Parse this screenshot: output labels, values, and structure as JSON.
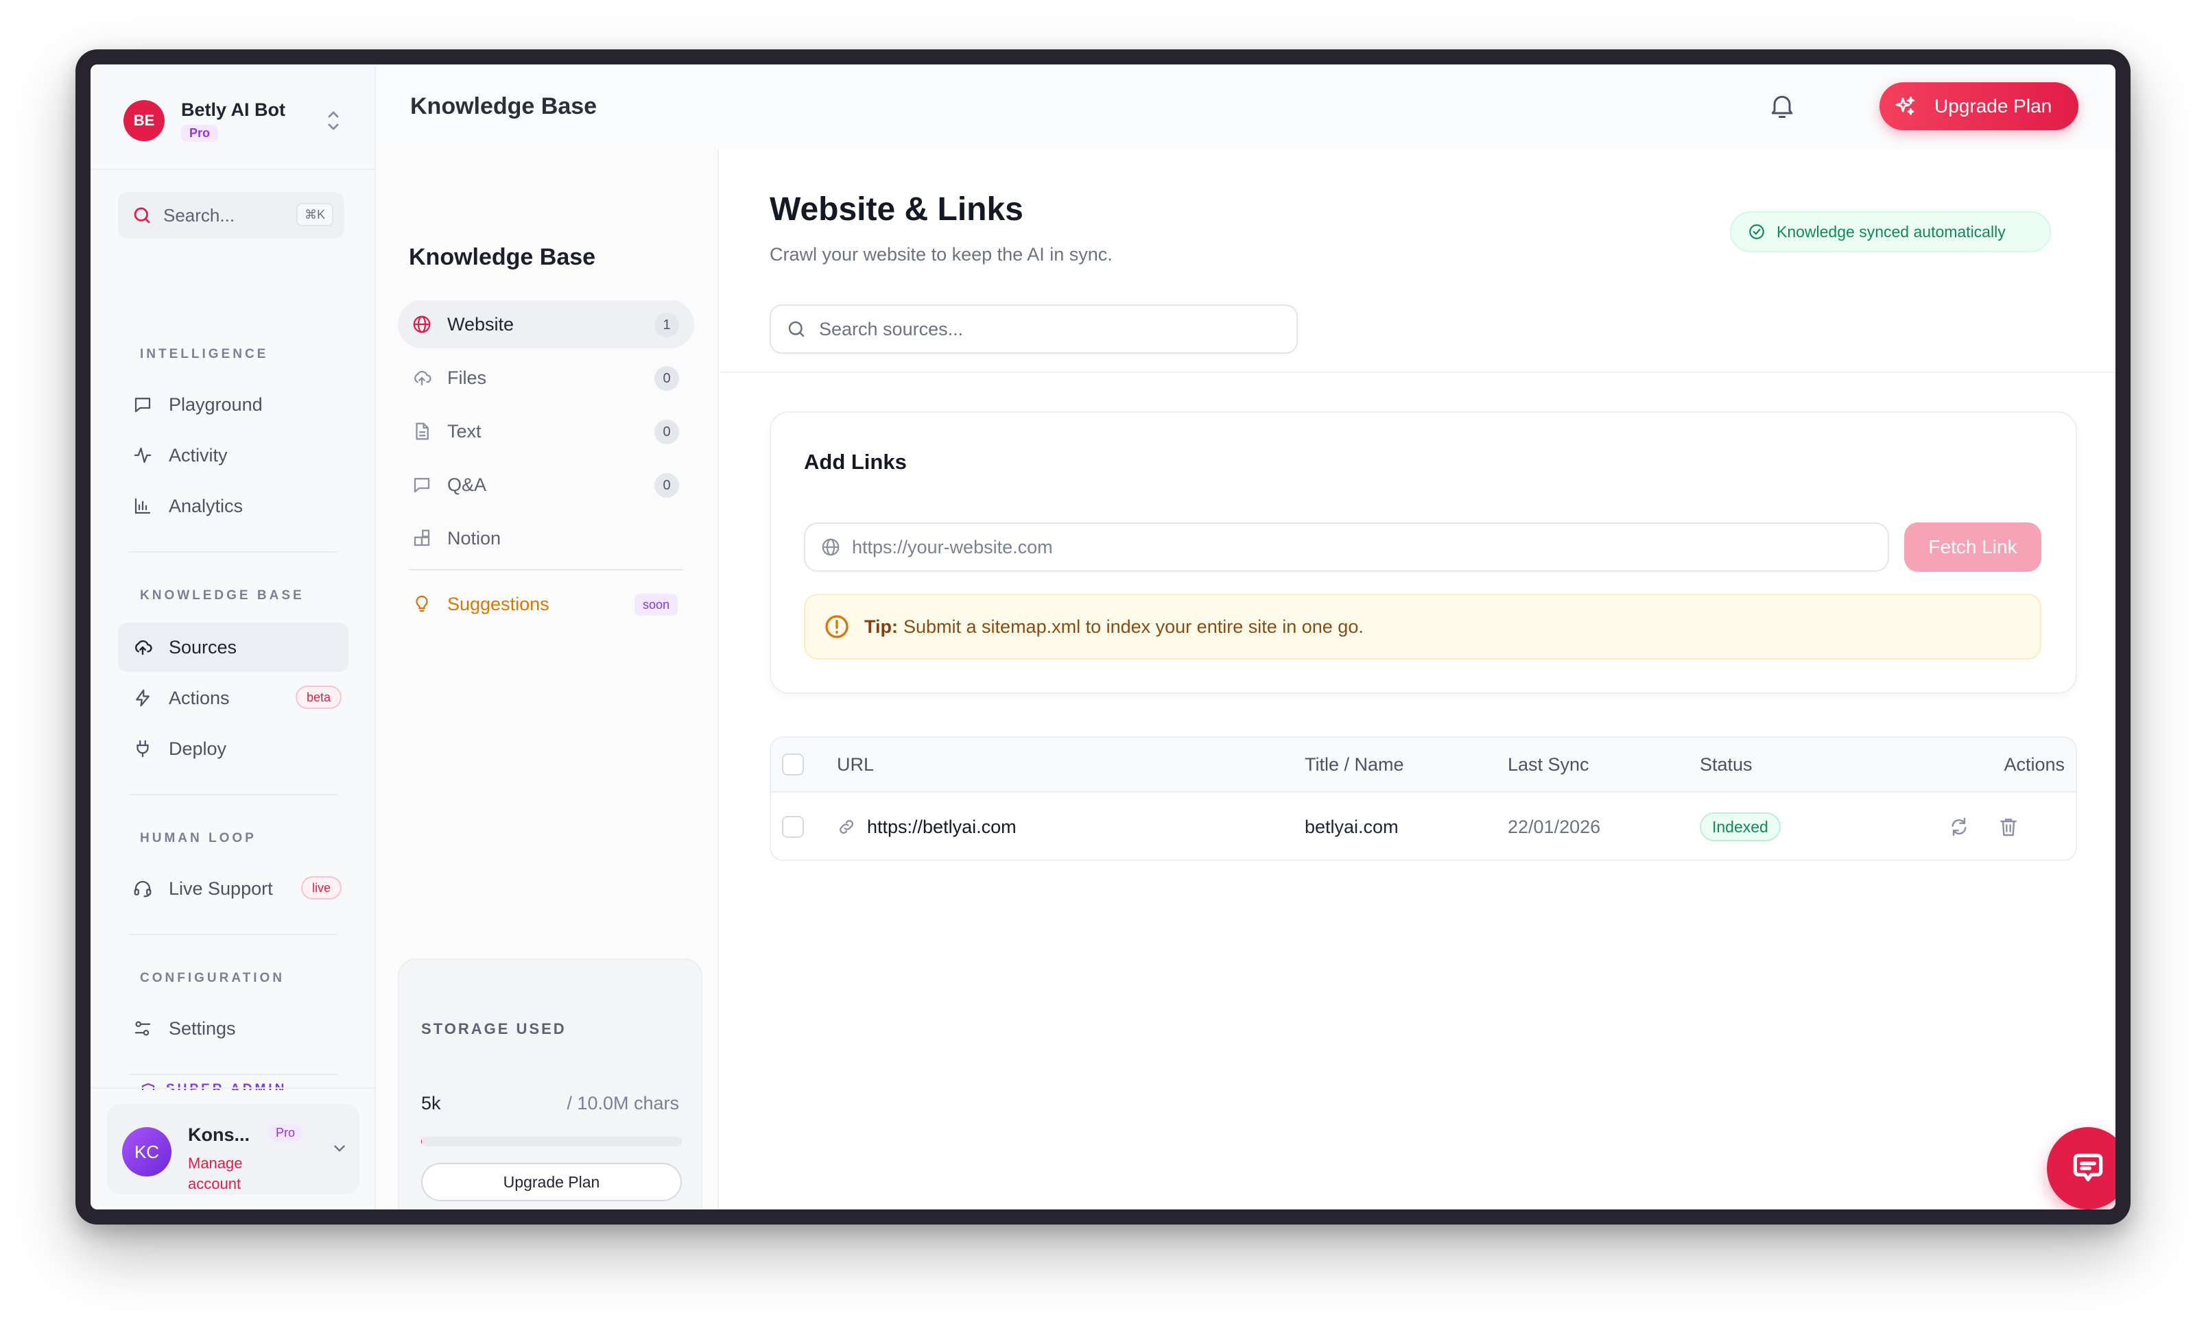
{
  "bot": {
    "initials": "BE",
    "name": "Betly AI Bot",
    "plan": "Pro"
  },
  "search": {
    "placeholder": "Search...",
    "shortcut": "⌘K"
  },
  "sidebar": {
    "sections": [
      {
        "label": "INTELLIGENCE",
        "items": [
          {
            "label": "Playground",
            "icon": "chat-square-icon"
          },
          {
            "label": "Activity",
            "icon": "activity-icon"
          },
          {
            "label": "Analytics",
            "icon": "bar-chart-icon"
          }
        ]
      },
      {
        "label": "KNOWLEDGE BASE",
        "items": [
          {
            "label": "Sources",
            "icon": "cloud-upload-icon",
            "active": true
          },
          {
            "label": "Actions",
            "icon": "bolt-icon",
            "badge": "beta"
          },
          {
            "label": "Deploy",
            "icon": "plug-icon"
          }
        ]
      },
      {
        "label": "HUMAN LOOP",
        "items": [
          {
            "label": "Live Support",
            "icon": "headset-icon",
            "badge": "live"
          }
        ]
      },
      {
        "label": "CONFIGURATION",
        "items": [
          {
            "label": "Settings",
            "icon": "sliders-icon"
          }
        ]
      },
      {
        "label": "SUPER ADMIN"
      }
    ]
  },
  "user": {
    "initials": "KC",
    "name": "Kons...",
    "plan": "Pro",
    "link": "Manage account"
  },
  "header": {
    "title": "Knowledge Base",
    "upgrade_label": "Upgrade Plan"
  },
  "kb_nav": {
    "title": "Knowledge Base",
    "items": [
      {
        "label": "Website",
        "count": "1",
        "active": true
      },
      {
        "label": "Files",
        "count": "0"
      },
      {
        "label": "Text",
        "count": "0"
      },
      {
        "label": "Q&A",
        "count": "0"
      },
      {
        "label": "Notion"
      }
    ],
    "suggestions": {
      "label": "Suggestions",
      "badge": "soon"
    },
    "storage": {
      "label": "STORAGE USED",
      "used": "5k",
      "capacity": "/ 10.0M chars",
      "fill_fraction": 0.0005,
      "button": "Upgrade Plan"
    }
  },
  "main": {
    "title": "Website & Links",
    "subtitle": "Crawl your website to keep the AI in sync.",
    "sync_status": "Knowledge synced automatically",
    "search_placeholder": "Search sources...",
    "add_links": {
      "title": "Add Links",
      "url_placeholder": "https://your-website.com",
      "fetch_label": "Fetch Link",
      "tip_strong": "Tip:",
      "tip_text": "Submit a sitemap.xml to index your entire site in one go."
    },
    "table": {
      "columns": [
        "URL",
        "Title / Name",
        "Last Sync",
        "Status",
        "Actions"
      ],
      "rows": [
        {
          "url": "https://betlyai.com",
          "title": "betlyai.com",
          "last_sync": "22/01/2026",
          "status": "Indexed"
        }
      ]
    }
  },
  "colors": {
    "accent": "#e11d48",
    "success": "#10875c",
    "warning": "#d97706",
    "purple": "#7c3aed"
  }
}
